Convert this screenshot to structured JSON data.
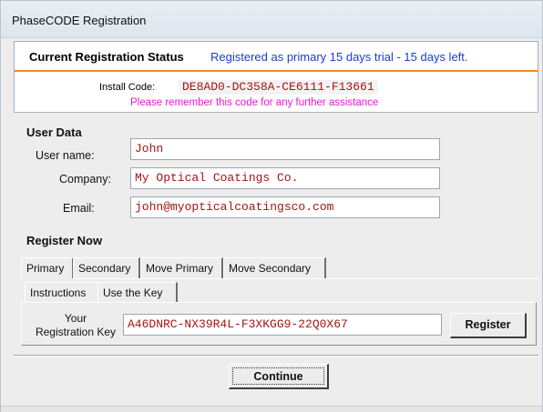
{
  "window": {
    "title": "PhaseCODE Registration"
  },
  "status": {
    "label": "Current Registration Status",
    "value": "Registered as primary 15 days trial - 15 days left."
  },
  "install": {
    "label": "Install Code:",
    "code": "DE8AD0-DC358A-CE6111-F13661",
    "note": "Please remember this code for any further assistance"
  },
  "user_data": {
    "heading": "User Data",
    "fields": [
      {
        "label": "User name:",
        "value": "John"
      },
      {
        "label": "Company:",
        "value": "My Optical Coatings Co."
      },
      {
        "label": "Email:",
        "value": "john@myopticalcoatingsco.com"
      }
    ]
  },
  "register": {
    "heading": "Register Now",
    "tabs": [
      "Primary",
      "Secondary",
      "Move Primary",
      "Move Secondary"
    ],
    "active_tab": "Primary",
    "subtabs": [
      "Instructions",
      "Use the Key"
    ],
    "active_subtab": "Use the Key",
    "key_label_line1": "Your",
    "key_label_line2": "Registration Key",
    "key_value": "A46DNRC-NX39R4L-F3XKGG9-22Q0X67",
    "register_button": "Register"
  },
  "footer": {
    "continue_button": "Continue"
  },
  "colors": {
    "status_value": "#1a3fd0",
    "code_text": "#a31515",
    "note_text": "#e51bd2",
    "accent_line": "#f28a24"
  }
}
